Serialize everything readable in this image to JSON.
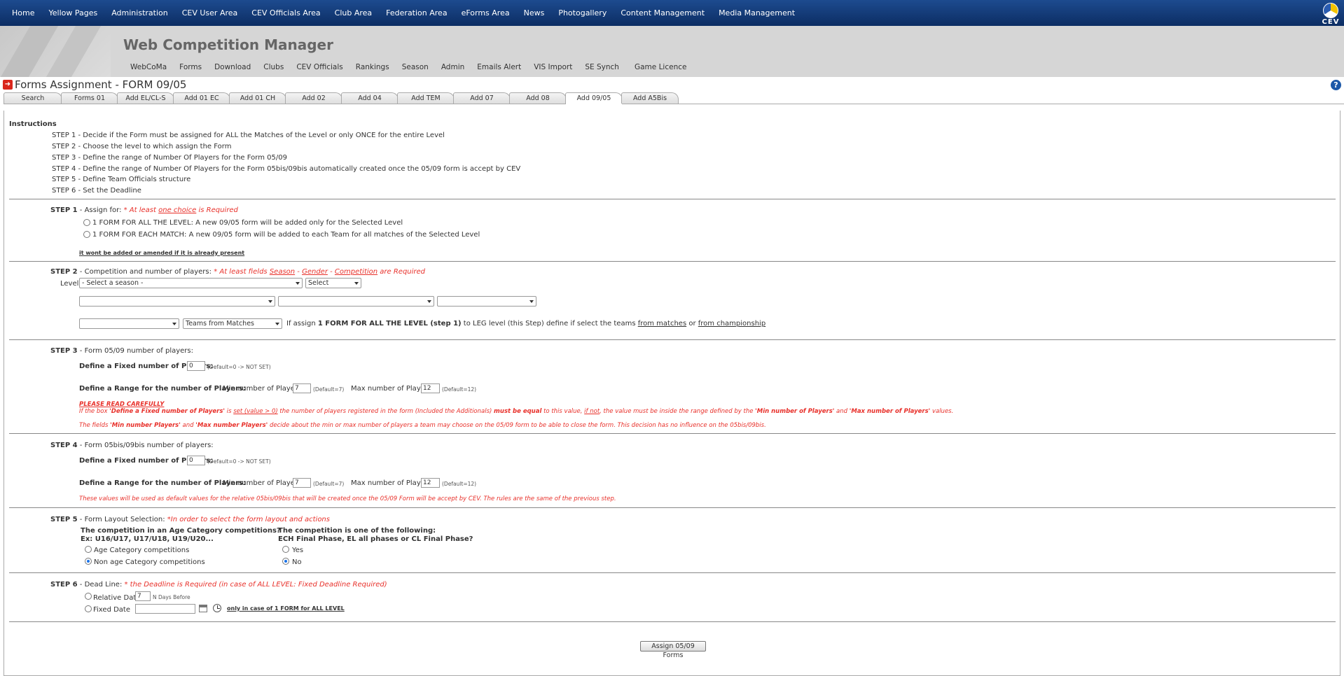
{
  "topnav": [
    "Home",
    "Yellow Pages",
    "Administration",
    "CEV User Area",
    "CEV Officials Area",
    "Club Area",
    "Federation Area",
    "eForms Area",
    "News",
    "Photogallery",
    "Content Management",
    "Media Management"
  ],
  "logo_text": "CEV",
  "app_title": "Web Competition Manager",
  "subnav": [
    "WebCoMa",
    "Forms",
    "Download",
    "Clubs",
    "CEV Officials",
    "Rankings",
    "Season",
    "Admin",
    "Emails Alert",
    "VIS Import",
    "SE Synch",
    "Game Licence"
  ],
  "page_title": "Forms Assignment - FORM 09/05",
  "help_icon": "?",
  "tabs": [
    "Search",
    "Forms 01",
    "Add EL/CL-S",
    "Add 01 EC",
    "Add 01 CH",
    "Add 02",
    "Add 04",
    "Add TEM",
    "Add 07",
    "Add 08",
    "Add 09/05",
    "Add A5Bis"
  ],
  "active_tab": "Add 09/05",
  "instructions": {
    "title": "Instructions",
    "steps": [
      "STEP 1 - Decide if the Form must be assigned for ALL the Matches of the Level or only ONCE for the entire Level",
      "STEP 2 - Choose the level to which assign the Form",
      "STEP 3 - Define the range of Number Of Players for the Form 05/09",
      "STEP 4 - Define the range of Number Of Players for the Form 05bis/09bis automatically created once the 05/09 form is accept by CEV",
      "STEP 5 - Define Team Officials structure",
      "STEP 6 - Set the Deadline"
    ]
  },
  "step1": {
    "label": "STEP 1",
    "text": " - Assign for: ",
    "req_a": "* At least ",
    "req_link": "one choice",
    "req_b": " is Required",
    "opt1": "1 FORM FOR ALL THE LEVEL: A new 09/05 form will be added only for the Selected Level",
    "opt2": "1 FORM FOR EACH MATCH: A new 09/05 form will be added to each Team for all matches of the Selected Level",
    "note": "it wont be added or amended if it is already present"
  },
  "step2": {
    "label": "STEP 2",
    "text": " - Competition and number of players: ",
    "req_a": "* At least fields ",
    "season": "Season",
    "dash1": " - ",
    "gender": "Gender",
    "dash2": " - ",
    "competition": "Competition",
    "req_b": " are Required",
    "level_label": "Level:",
    "season_select": "- Select a season -",
    "select2": "Select",
    "teams_select": "Teams from Matches",
    "hint_a": "If assign ",
    "hint_bold": "1 FORM FOR ALL THE LEVEL (step 1)",
    "hint_b": " to LEG level (this Step) define if select the teams ",
    "hint_link1": "from matches",
    "hint_or": " or ",
    "hint_link2": "from championship"
  },
  "step3": {
    "label": "STEP 3",
    "text": " - Form 05/09 number of players:",
    "fixed_label": "Define a Fixed number of Players:",
    "fixed_value": "0",
    "fixed_default": "(Default=0 -> NOT SET)",
    "range_label": "Define a Range for the number of Players:",
    "min_label": "Min number of Players:",
    "min_value": "7",
    "min_default": "(Default=7)",
    "max_label": "Max number of Players:",
    "max_value": "12",
    "max_default": "(Default=12)",
    "warn_title": "PLEASE READ CAREFULLY",
    "warn1_a": "If the box ",
    "warn1_b": "'Define a Fixed number of Players'",
    "warn1_c": " is ",
    "warn1_d": "set (value > 0)",
    "warn1_e": " the number of players registered in the form (Included the Additionals) ",
    "warn1_f": "must be equal",
    "warn1_g": " to this value, ",
    "warn1_h": "if not",
    "warn1_i": ", the value must be inside the range defined by the ",
    "warn1_j": "'Min number of Players'",
    "warn1_k": " and ",
    "warn1_l": "'Max number of Players'",
    "warn1_m": " values.",
    "warn2_a": "The fields ",
    "warn2_b": "'Min number Players'",
    "warn2_c": " and ",
    "warn2_d": "'Max number Players'",
    "warn2_e": " decide about the min or max number of players a team may choose on the 05/09 form to be able to close the form. This decision has no influence on the 05bis/09bis."
  },
  "step4": {
    "label": "STEP 4",
    "text": " - Form 05bis/09bis number of players:",
    "fixed_label": "Define a Fixed number of Players:",
    "fixed_value": "0",
    "fixed_default": "(Default=0 -> NOT SET)",
    "range_label": "Define a Range for the number of Players:",
    "min_label": "Min number of Players:",
    "min_value": "7",
    "min_default": "(Default=7)",
    "max_label": "Max number of Players:",
    "max_value": "12",
    "max_default": "(Default=12)",
    "note": "These values will be used as default values for the relative 05bis/09bis that will be created once the 05/09 Form will be accept by CEV. The rules are the same of the previous step."
  },
  "step5": {
    "label": "STEP 5",
    "text": " - Form Layout Selection: ",
    "req": "*In order to select the form layout and actions",
    "q1_a": "The competition in an Age Category competitions?",
    "q1_b": "Ex: U16/U17, U17/U18, U19/U20...",
    "q1_opt1": "Age Category competitions",
    "q1_opt2": "Non age Category competitions",
    "q2_a": "The competition is one of the following:",
    "q2_b": "ECH Final Phase, EL all phases or CL Final Phase?",
    "q2_opt1": "Yes",
    "q2_opt2": "No"
  },
  "step6": {
    "label": "STEP 6",
    "text": " - Dead Line: ",
    "req": "* the Deadline is Required (in case of ALL LEVEL: Fixed Deadline Required)",
    "opt1": "Relative Date",
    "rel_value": "7",
    "rel_suffix": "N Days Before",
    "opt2": "Fixed Date",
    "fixed_note": "only in case of 1 FORM for ALL LEVEL"
  },
  "submit": "Assign 05/09 Forms"
}
